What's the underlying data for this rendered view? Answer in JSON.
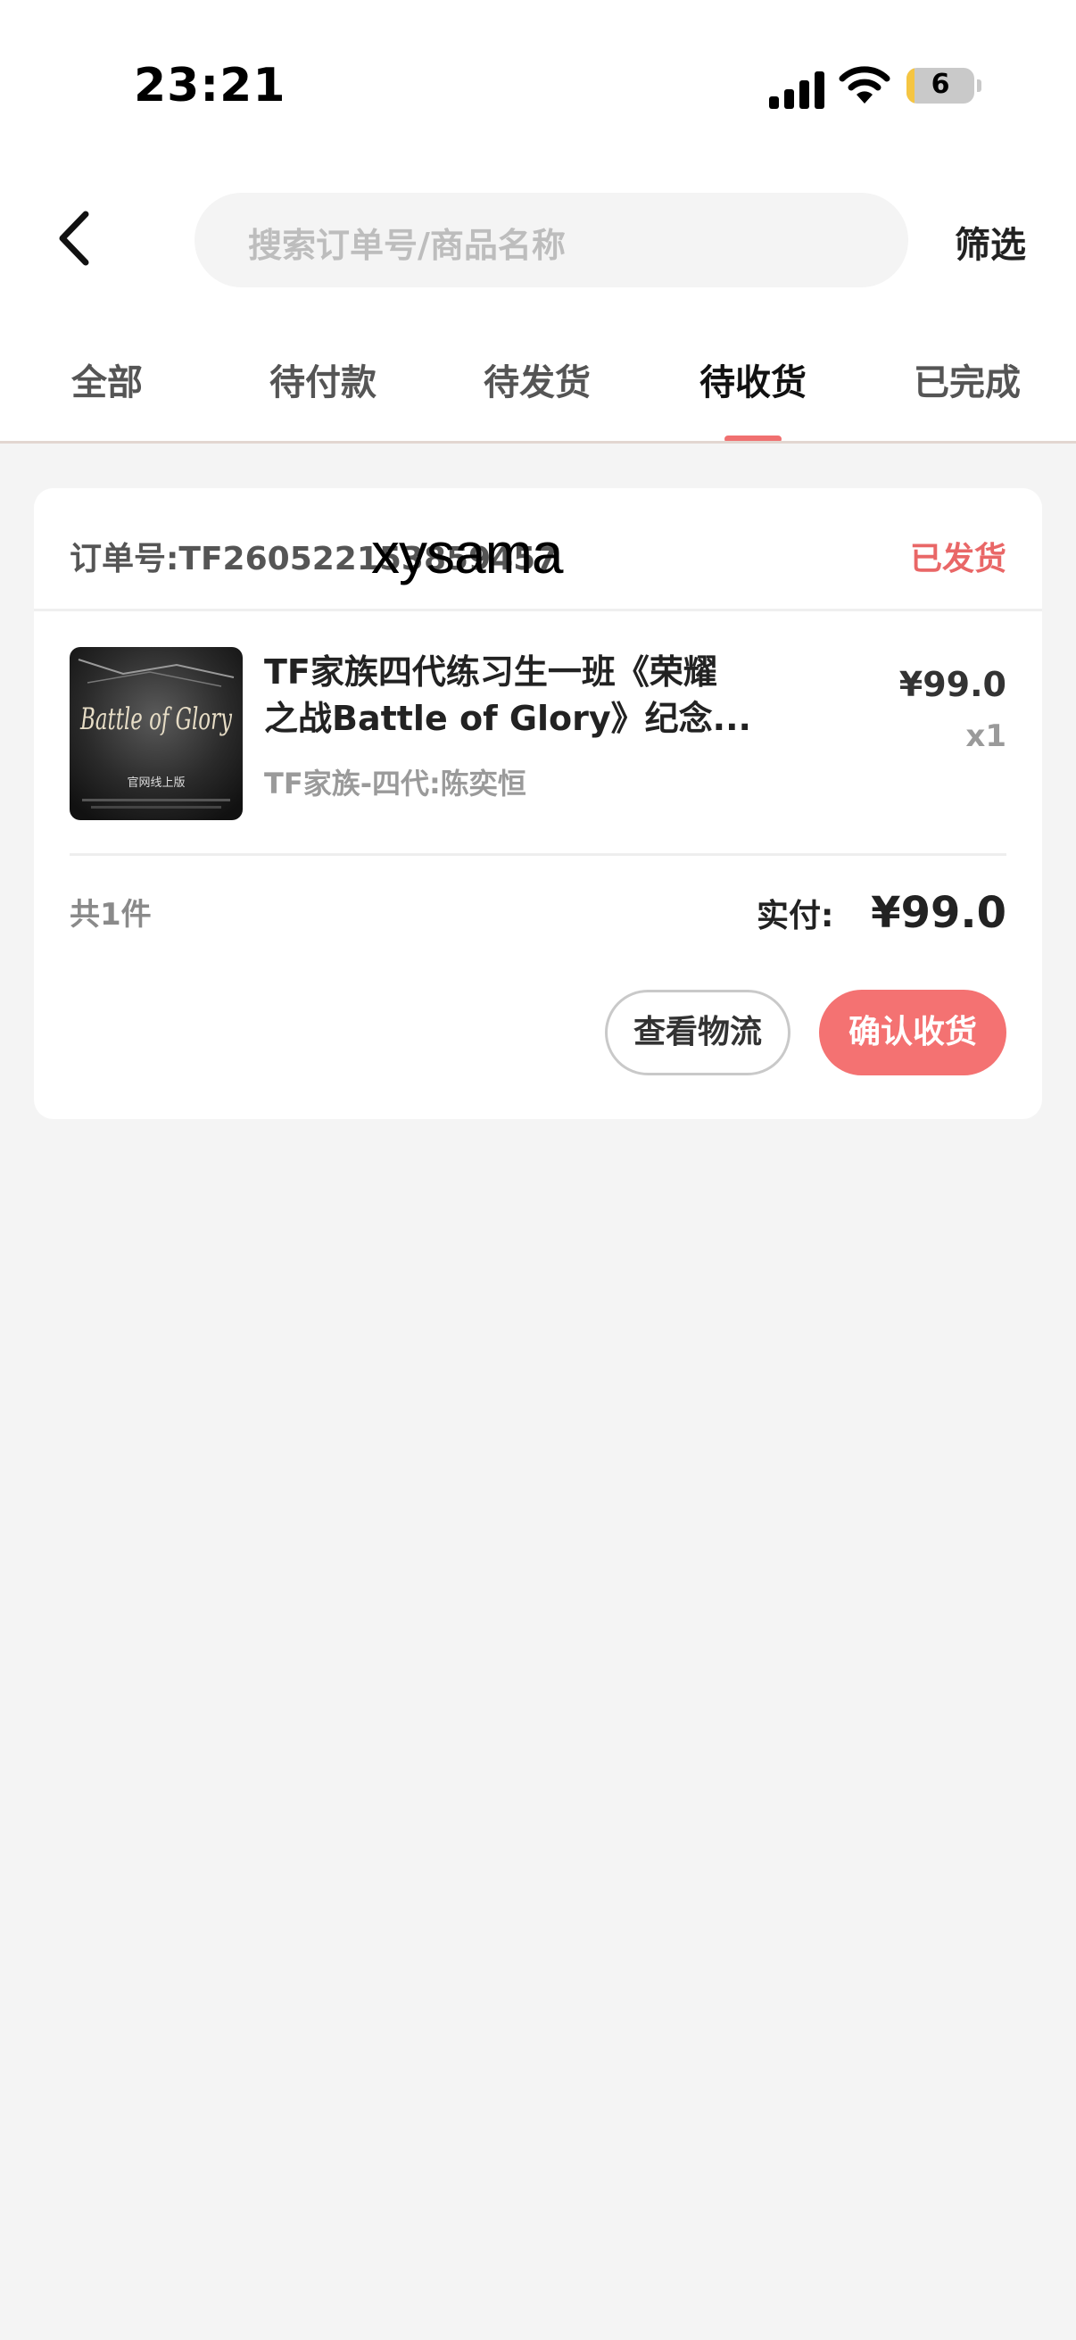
{
  "status_bar": {
    "time": "23:21",
    "battery": "6"
  },
  "header": {
    "search_placeholder": "搜索订单号/商品名称",
    "filter_label": "筛选"
  },
  "tabs": [
    {
      "label": "全部"
    },
    {
      "label": "待付款"
    },
    {
      "label": "待发货"
    },
    {
      "label": "待收货",
      "active": true
    },
    {
      "label": "已完成"
    }
  ],
  "order": {
    "number_label": "订单号:TF260522153859457",
    "status": "已发货",
    "watermark": "xysama",
    "product": {
      "title_line1": "TF家族四代练习生一班《荣耀",
      "title_line2": "之战Battle of Glory》纪念...",
      "spec": "TF家族-四代:陈奕恒",
      "price": "¥99.0",
      "qty": "x1",
      "image_text": "Battle of Glory",
      "image_subtext": "官网线上版"
    },
    "total_count": "共1件",
    "paid_label": "实付:",
    "paid_amount": "¥99.0",
    "buttons": {
      "logistics": "查看物流",
      "confirm": "确认收货"
    }
  },
  "colors": {
    "accent": "#f47272",
    "status_red": "#e96767",
    "background": "#f4f4f4"
  }
}
